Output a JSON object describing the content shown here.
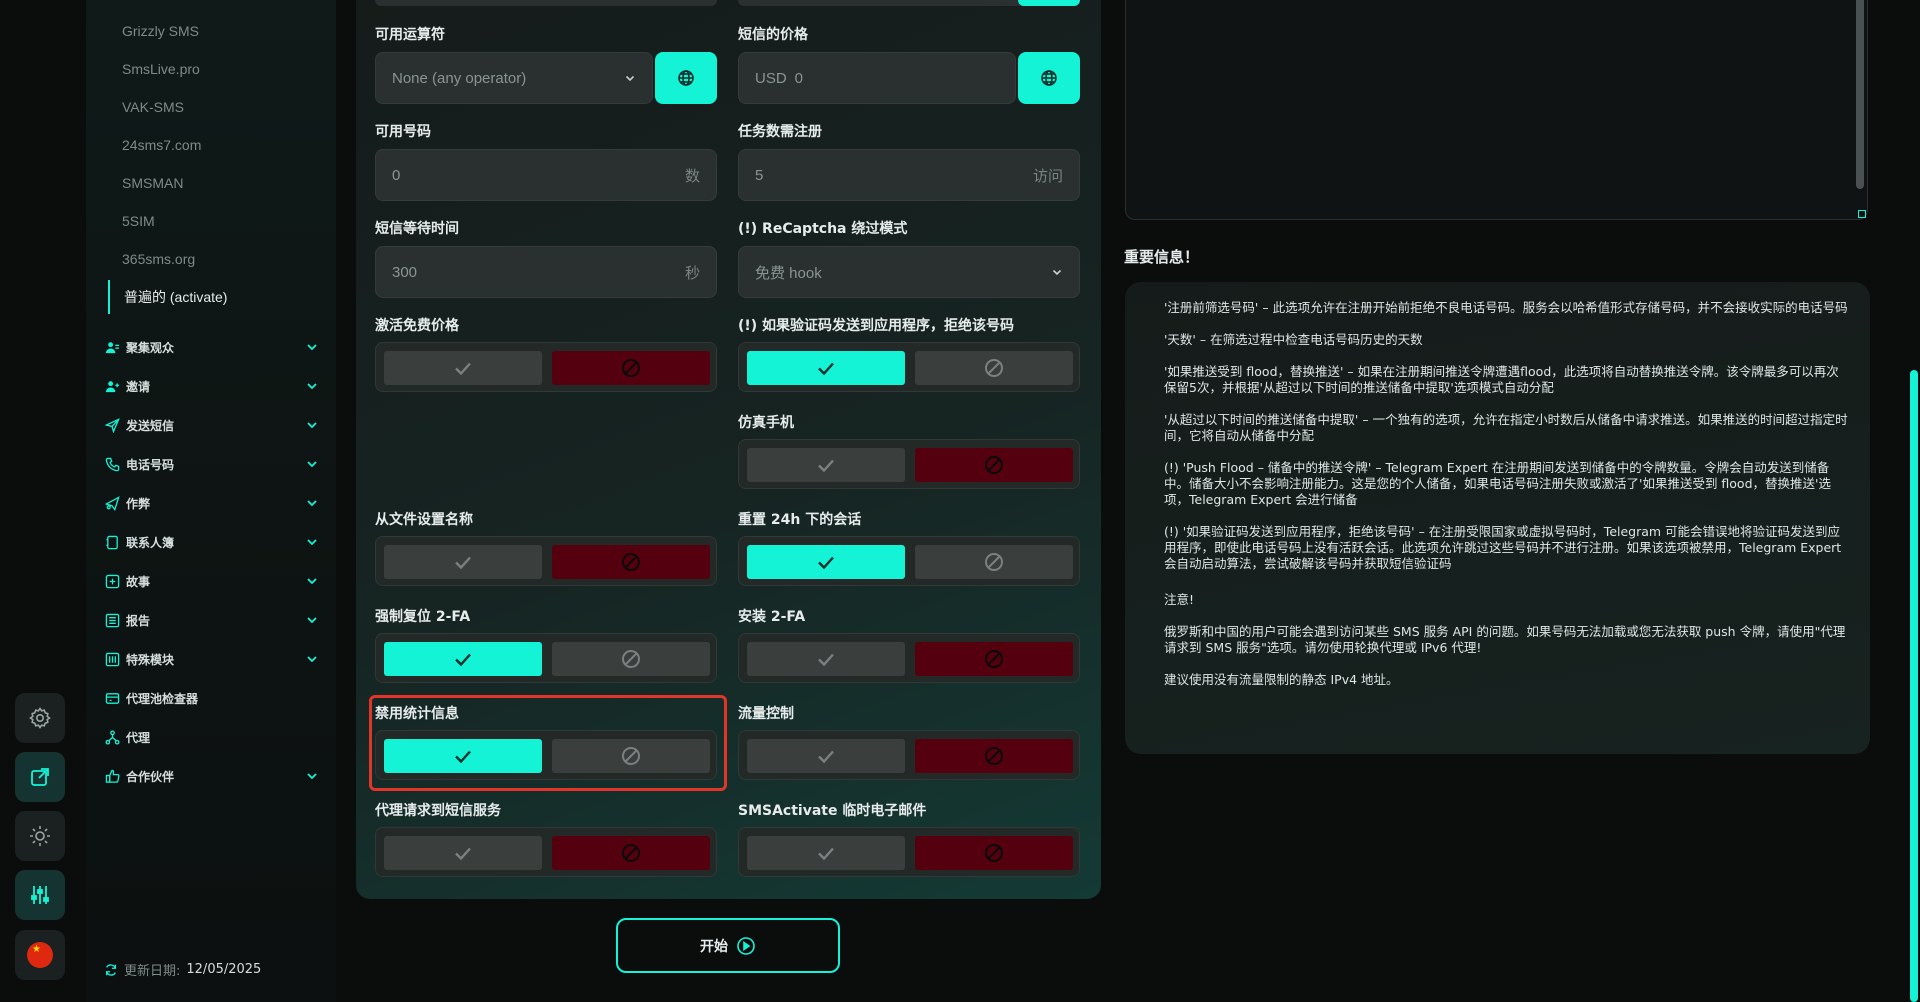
{
  "sidebar": {
    "sub_items": [
      "Grizzly SMS",
      "SmsLive.pro",
      "VAK-SMS",
      "24sms7.com",
      "SMSMAN",
      "5SIM",
      "365sms.org",
      "普遍的 (activate)"
    ],
    "nav_items": [
      {
        "label": "聚集观众",
        "icon": "users-icon",
        "chevron": true
      },
      {
        "label": "邀请",
        "icon": "user-plus-icon",
        "chevron": true
      },
      {
        "label": "发送短信",
        "icon": "send-icon",
        "chevron": true
      },
      {
        "label": "电话号码",
        "icon": "phone-icon",
        "chevron": true
      },
      {
        "label": "作弊",
        "icon": "megaphone-icon",
        "chevron": true
      },
      {
        "label": "联系人簿",
        "icon": "contacts-icon",
        "chevron": true
      },
      {
        "label": "故事",
        "icon": "story-icon",
        "chevron": true
      },
      {
        "label": "报告",
        "icon": "report-icon",
        "chevron": true
      },
      {
        "label": "特殊模块",
        "icon": "module-icon",
        "chevron": true
      },
      {
        "label": "代理池检查器",
        "icon": "proxy-checker-icon",
        "chevron": false
      },
      {
        "label": "代理",
        "icon": "network-icon",
        "chevron": false
      },
      {
        "label": "合作伙伴",
        "icon": "handshake-icon",
        "chevron": true
      }
    ],
    "update_label": "更新日期:",
    "update_date": "12/05/2025"
  },
  "rail": [
    "settings-icon",
    "external-link-icon",
    "theme-icon",
    "sliders-icon",
    "china-flag-icon"
  ],
  "form": {
    "operator_label": "可用运算符",
    "operator_value": "None (any operator)",
    "price_label": "短信的价格",
    "price_currency": "USD",
    "price_value": "0",
    "numbers_label": "可用号码",
    "numbers_value": "0",
    "numbers_suffix": "数",
    "tasks_label": "任务数需注册",
    "tasks_value": "5",
    "tasks_suffix": "访问",
    "wait_label": "短信等待时间",
    "wait_value": "300",
    "wait_suffix": "秒",
    "recaptcha_label": "(!) ReCaptcha 绕过模式",
    "recaptcha_value": "免费 hook",
    "toggles": {
      "free_price": {
        "label": "激活免费价格",
        "state": "no"
      },
      "reject_if_sent_to_app": {
        "label": "(!) 如果验证码发送到应用程序，拒绝该号码",
        "state": "yes"
      },
      "emulator": {
        "label": "仿真手机",
        "state": "no"
      },
      "name_from_file": {
        "label": "从文件设置名称",
        "state": "no"
      },
      "reset_24h": {
        "label": "重置 24h 下的会话",
        "state": "yes"
      },
      "force_reset_2fa": {
        "label": "强制复位 2-FA",
        "state": "yes"
      },
      "install_2fa": {
        "label": "安装 2-FA",
        "state": "no"
      },
      "disable_stats": {
        "label": "禁用统计信息",
        "state": "yes"
      },
      "traffic_control": {
        "label": "流量控制",
        "state": "no"
      },
      "proxy_sms": {
        "label": "代理请求到短信服务",
        "state": "no"
      },
      "temp_email": {
        "label": "SMSActivate 临时电子邮件",
        "state": "no"
      }
    },
    "start_label": "开始"
  },
  "info": {
    "title": "重要信息！",
    "paragraphs": [
      "'注册前筛选号码' – 此选项允许在注册开始前拒绝不良电话号码。服务会以哈希值形式存储号码，并不会接收实际的电话号码",
      "'天数' – 在筛选过程中检查电话号码历史的天数",
      "'如果推送受到 flood，替换推送' – 如果在注册期间推送令牌遭遇flood，此选项将自动替换推送令牌。该令牌最多可以再次保留5次，并根据'从超过以下时间的推送储备中提取'选项模式自动分配",
      "'从超过以下时间的推送储备中提取' – 一个独有的选项，允许在指定小时数后从储备中请求推送。如果推送的时间超过指定时间，它将自动从储备中分配",
      "(!) 'Push Flood – 储备中的推送令牌' – Telegram Expert 在注册期间发送到储备中的令牌数量。令牌会自动发送到储备中。储备大小不会影响注册能力。这是您的个人储备，如果电话号码注册失败或激活了'如果推送受到 flood，替换推送'选项，Telegram Expert 会进行储备",
      "(!) '如果验证码发送到应用程序，拒绝该号码' – 在注册受限国家或虚拟号码时，Telegram 可能会错误地将验证码发送到应用程序，即使此电话号码上没有活跃会话。此选项允许跳过这些号码并不进行注册。如果该选项被禁用，Telegram Expert 会自动启动算法，尝试破解该号码并获取短信验证码",
      "注意!",
      "俄罗斯和中国的用户可能会遇到访问某些 SMS 服务 API 的问题。如果号码无法加载或您无法获取 push 令牌，请使用\"代理请求到 SMS 服务\"选项。请勿使用轮换代理或 IPv6 代理!",
      "建议使用没有流量限制的静态 IPv4 地址。"
    ]
  },
  "colors": {
    "accent": "#14f3d6",
    "deny": "#55000e",
    "highlight": "#e0362a"
  }
}
